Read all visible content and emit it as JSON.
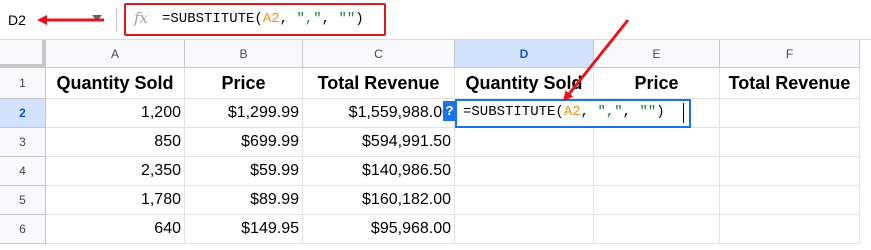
{
  "name_box": {
    "cell_ref": "D2"
  },
  "formula_bar": {
    "fx_label": "fx",
    "formula": {
      "prefix": "=SUBSTITUTE(",
      "ref": "A2",
      "sep1": ", ",
      "str1": "\",\"",
      "sep2": ", ",
      "str2": "\"\"",
      "suffix": ")"
    }
  },
  "columns": [
    "A",
    "B",
    "C",
    "D",
    "E",
    "F"
  ],
  "selected_column": "D",
  "selected_row": "2",
  "rows": [
    "1",
    "2",
    "3",
    "4",
    "5",
    "6"
  ],
  "header_row": [
    "Quantity Sold",
    "Price",
    "Total Revenue",
    "Quantity Sold",
    "Price",
    "Total Revenue"
  ],
  "data_rows": [
    [
      "1,200",
      "$1,299.99",
      "$1,559,988.00"
    ],
    [
      "850",
      "$699.99",
      "$594,991.50"
    ],
    [
      "2,350",
      "$59.99",
      "$140,986.50"
    ],
    [
      "1,780",
      "$89.99",
      "$160,182.00"
    ],
    [
      "640",
      "$149.95",
      "$95,968.00"
    ]
  ],
  "active_cell": {
    "ref": "D2",
    "help_label": "?",
    "formula": {
      "prefix": "=SUBSTITUTE(",
      "ref": "A2",
      "sep1": ", ",
      "str1": "\",\"",
      "sep2": ", ",
      "str2": "\"\"",
      "suffix": ")"
    }
  },
  "colors": {
    "annotation_red": "#e0171e",
    "selection_blue": "#1a73e8",
    "header_selected_bg": "#d3e3fd",
    "range_ref": "#e8940c",
    "string_literal": "#188038"
  }
}
